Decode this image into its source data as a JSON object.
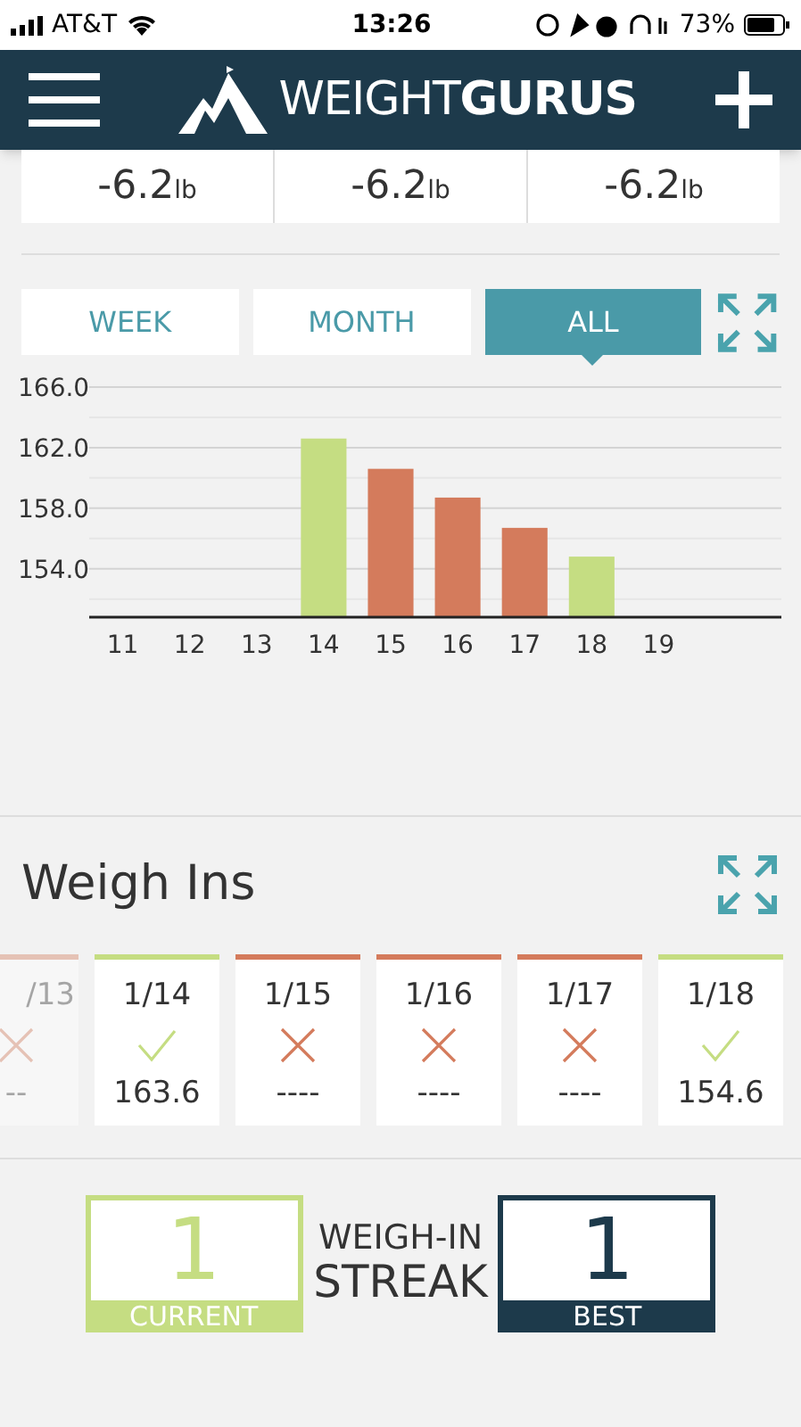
{
  "status_bar": {
    "carrier": "AT&T",
    "time": "13:26",
    "battery": "73%"
  },
  "header": {
    "brand_light": "WEIGHT",
    "brand_bold": "GURUS"
  },
  "stats": [
    {
      "value": "-6.2",
      "unit": "lb"
    },
    {
      "value": "-6.2",
      "unit": "lb"
    },
    {
      "value": "-6.2",
      "unit": "lb"
    }
  ],
  "tabs": [
    {
      "label": "WEEK",
      "selected": false
    },
    {
      "label": "MONTH",
      "selected": false
    },
    {
      "label": "ALL",
      "selected": true
    }
  ],
  "chart_data": {
    "type": "bar",
    "categories": [
      "11",
      "12",
      "13",
      "14",
      "15",
      "16",
      "17",
      "18",
      "19"
    ],
    "grid": true,
    "series": [
      {
        "color": "#c5dd82",
        "values": [
          null,
          null,
          null,
          162.6,
          null,
          null,
          null,
          154.8,
          null
        ]
      },
      {
        "color": "#d47b5c",
        "values": [
          null,
          null,
          null,
          null,
          160.6,
          158.7,
          156.7,
          null,
          null
        ]
      }
    ],
    "ylim": [
      150.8,
      166
    ],
    "yticks": [
      {
        "value": 154,
        "label": "154.0"
      },
      {
        "value": 158,
        "label": "158.0"
      },
      {
        "value": 162,
        "label": "162.0"
      },
      {
        "value": 166,
        "label": "166.0"
      }
    ]
  },
  "weigh_ins": {
    "title": "Weigh Ins",
    "cards": [
      {
        "date": "/13",
        "kind": "missed",
        "value": "--",
        "faded": true
      },
      {
        "date": "1/14",
        "kind": "ok",
        "value": "163.6",
        "faded": false
      },
      {
        "date": "1/15",
        "kind": "missed",
        "value": "----",
        "faded": false
      },
      {
        "date": "1/16",
        "kind": "missed",
        "value": "----",
        "faded": false
      },
      {
        "date": "1/17",
        "kind": "missed",
        "value": "----",
        "faded": false
      },
      {
        "date": "1/18",
        "kind": "ok",
        "value": "154.6",
        "faded": false
      }
    ]
  },
  "streak": {
    "current": {
      "value": "1",
      "label": "CURRENT"
    },
    "title_1": "WEIGH-IN",
    "title_2": "STREAK",
    "best": {
      "value": "1",
      "label": "BEST"
    }
  }
}
